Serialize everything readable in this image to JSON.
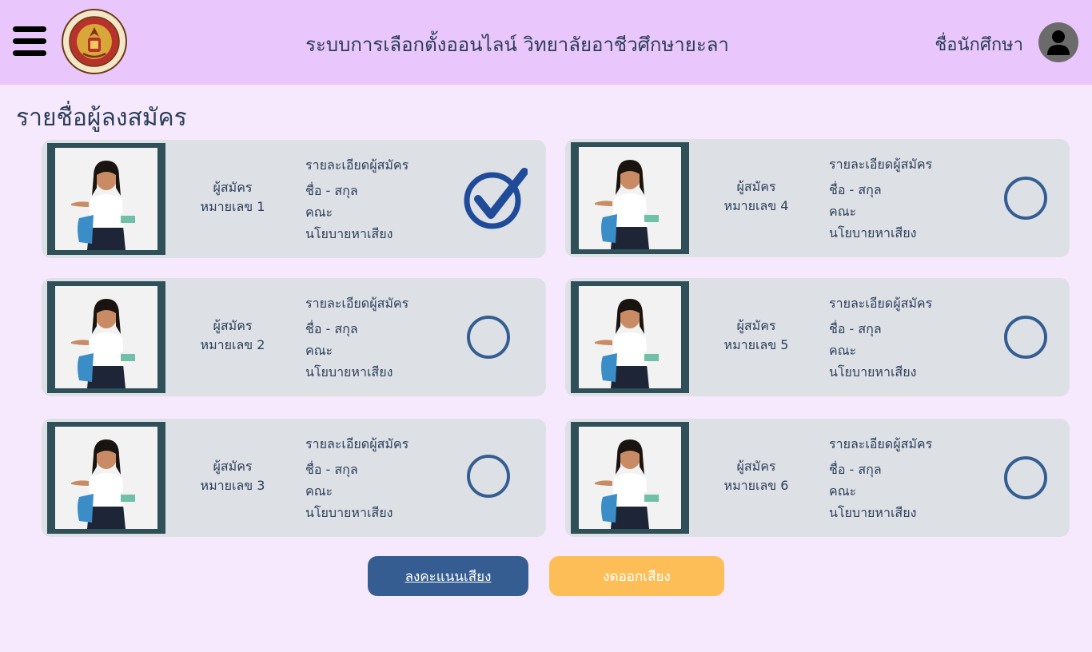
{
  "header": {
    "title": "ระบบการเลือกตั้งออนไลน์  วิทยาลัยอาชีวศึกษายะลา",
    "student_name": "ชื่อนักศึกษา",
    "menu_icon": "hamburger-menu-icon",
    "logo_text": "วิทยาลัยอาชีวศึกษายะลา YALA VOCATIONAL COLLEGE",
    "avatar_icon": "user-avatar-icon"
  },
  "page": {
    "title": "รายชื่อผู้ลงสมัคร"
  },
  "candidates": [
    {
      "label": "ผู้สมัคร",
      "number": "หมายเลข 1",
      "details_heading": "รายละเอียดผู้สมัคร",
      "name": "ชื่อ - สกุล",
      "faculty": "คณะ",
      "policy": "นโยบายหาเสียง",
      "selected": true
    },
    {
      "label": "ผู้สมัคร",
      "number": "หมายเลข 2",
      "details_heading": "รายละเอียดผู้สมัคร",
      "name": "ชื่อ - สกุล",
      "faculty": "คณะ",
      "policy": "นโยบายหาเสียง",
      "selected": false
    },
    {
      "label": "ผู้สมัคร",
      "number": "หมายเลข 3",
      "details_heading": "รายละเอียดผู้สมัคร",
      "name": "ชื่อ - สกุล",
      "faculty": "คณะ",
      "policy": "นโยบายหาเสียง",
      "selected": false
    },
    {
      "label": "ผู้สมัคร",
      "number": "หมายเลข 4",
      "details_heading": "รายละเอียดผู้สมัคร",
      "name": "ชื่อ - สกุล",
      "faculty": "คณะ",
      "policy": "นโยบายหาเสียง",
      "selected": false
    },
    {
      "label": "ผู้สมัคร",
      "number": "หมายเลข 5",
      "details_heading": "รายละเอียดผู้สมัคร",
      "name": "ชื่อ - สกุล",
      "faculty": "คณะ",
      "policy": "นโยบายหาเสียง",
      "selected": false
    },
    {
      "label": "ผู้สมัคร",
      "number": "หมายเลข 6",
      "details_heading": "รายละเอียดผู้สมัคร",
      "name": "ชื่อ - สกุล",
      "faculty": "คณะ",
      "policy": "นโยบายหาเสียง",
      "selected": false
    }
  ],
  "actions": {
    "vote_label": "ลงคะแนนเสียง",
    "abstain_label": "งดออกเสียง"
  },
  "colors": {
    "header_bg": "#e9c6fb",
    "page_bg": "#f6e9fd",
    "card_bg": "#dde1e6",
    "photo_frame": "#2f5058",
    "select_ring": "#355d92",
    "check_mark": "#1f4b99",
    "vote_button": "#355d92",
    "abstain_button": "#fdbe57",
    "text": "#2c3e5a"
  }
}
